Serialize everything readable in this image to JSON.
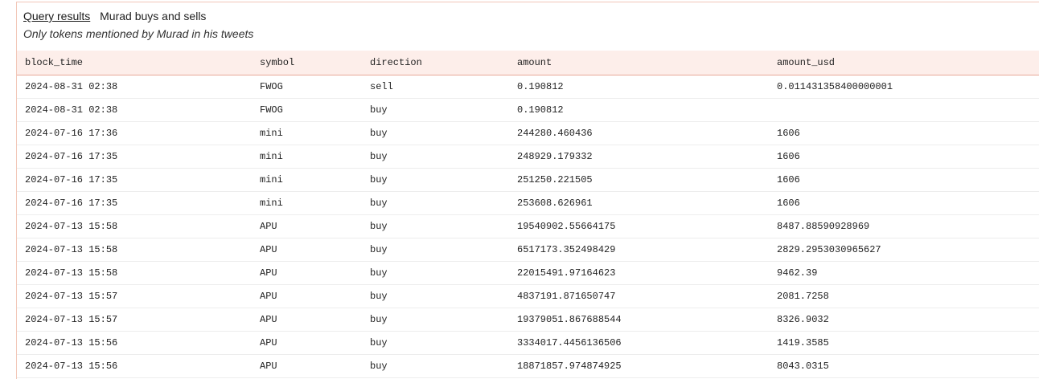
{
  "header": {
    "tab_label": "Query results",
    "title": "Murad buys and sells",
    "subtitle": "Only tokens mentioned by Murad in his tweets"
  },
  "table": {
    "columns": [
      "block_time",
      "symbol",
      "direction",
      "amount",
      "amount_usd"
    ],
    "rows": [
      [
        "2024-08-31 02:38",
        "FWOG",
        "sell",
        "0.190812",
        "0.011431358400000001"
      ],
      [
        "2024-08-31 02:38",
        "FWOG",
        "buy",
        "0.190812",
        ""
      ],
      [
        "2024-07-16 17:36",
        "mini",
        "buy",
        "244280.460436",
        "1606"
      ],
      [
        "2024-07-16 17:35",
        "mini",
        "buy",
        "248929.179332",
        "1606"
      ],
      [
        "2024-07-16 17:35",
        "mini",
        "buy",
        "251250.221505",
        "1606"
      ],
      [
        "2024-07-16 17:35",
        "mini",
        "buy",
        "253608.626961",
        "1606"
      ],
      [
        "2024-07-13 15:58",
        "APU",
        "buy",
        "19540902.55664175",
        "8487.88590928969"
      ],
      [
        "2024-07-13 15:58",
        "APU",
        "buy",
        "6517173.352498429",
        "2829.2953030965627"
      ],
      [
        "2024-07-13 15:58",
        "APU",
        "buy",
        "22015491.97164623",
        "9462.39"
      ],
      [
        "2024-07-13 15:57",
        "APU",
        "buy",
        "4837191.871650747",
        "2081.7258"
      ],
      [
        "2024-07-13 15:57",
        "APU",
        "buy",
        "19379051.867688544",
        "8326.9032"
      ],
      [
        "2024-07-13 15:56",
        "APU",
        "buy",
        "3334017.4456136506",
        "1419.3585"
      ],
      [
        "2024-07-13 15:56",
        "APU",
        "buy",
        "18871857.974874925",
        "8043.0315"
      ]
    ]
  }
}
